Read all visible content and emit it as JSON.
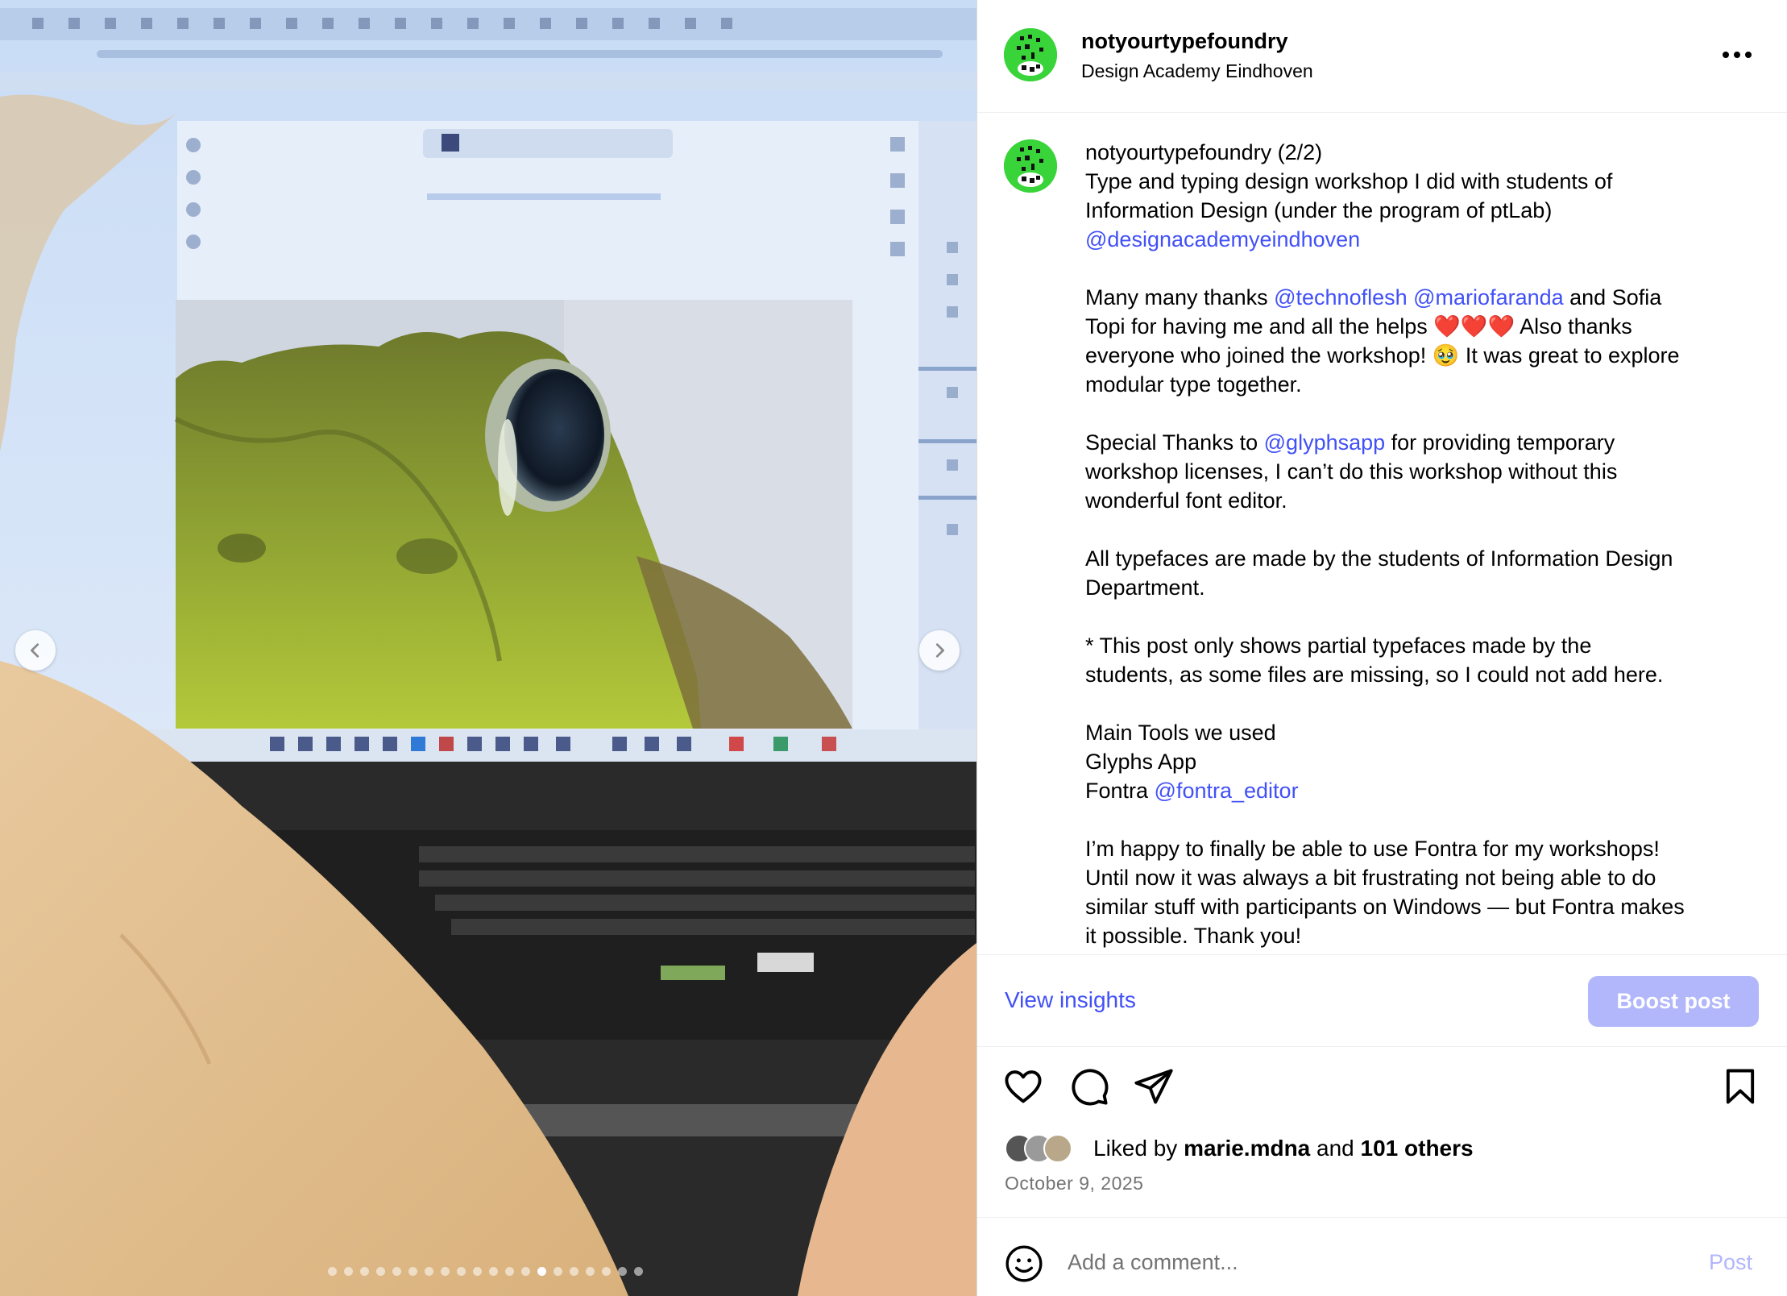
{
  "post": {
    "username": "notyourtypefoundry",
    "location": "Design Academy Eindhoven"
  },
  "caption": {
    "username": "notyourtypefoundry",
    "segments": [
      {
        "t": " (2/2)\nType and typing design workshop I did with students of\nInformation Design (under the program of ptLab)\n",
        "m": false
      },
      {
        "t": "@designacademyeindhoven",
        "m": true
      },
      {
        "t": "\n\nMany many thanks ",
        "m": false
      },
      {
        "t": "@technoflesh",
        "m": true
      },
      {
        "t": " ",
        "m": false
      },
      {
        "t": "@mariofaranda",
        "m": true
      },
      {
        "t": " and Sofia\nTopi for having me and all the helps ❤️❤️❤️ Also thanks\neveryone who joined the workshop! 🥹 It was great to explore\nmodular type together.\n\nSpecial Thanks to ",
        "m": false
      },
      {
        "t": "@glyphsapp",
        "m": true
      },
      {
        "t": " for providing temporary\nworkshop licenses, I can’t do this workshop without this\nwonderful font editor.\n\nAll typefaces are made by the students of Information Design\nDepartment.\n\n* This post only shows partial typefaces made by the\nstudents, as some files are missing, so I could not add here.\n\nMain Tools we used\nGlyphs App\nFontra ",
        "m": false
      },
      {
        "t": "@fontra_editor",
        "m": true
      },
      {
        "t": "\n\nI’m happy to finally be able to use Fontra for my workshops!\nUntil now it was always a bit frustrating not being able to do\nsimilar stuff with participants on Windows — but Fontra makes\nit possible. Thank you!",
        "m": false
      }
    ]
  },
  "insights": {
    "view_label": "View insights",
    "boost_label": "Boost post"
  },
  "likes": {
    "prefix": "Liked by ",
    "user": "marie.mdna",
    "middle": " and ",
    "others": "101 others"
  },
  "date": "October 9, 2025",
  "comment": {
    "placeholder": "Add a comment...",
    "post_label": "Post"
  },
  "carousel": {
    "total": 20,
    "active_index": 13
  },
  "icons": {
    "like": "heart-icon",
    "comment": "comment-bubble-icon",
    "share": "paper-plane-icon",
    "save": "bookmark-icon",
    "more": "ellipsis-icon",
    "emoji": "smiley-icon",
    "prev": "chevron-left-icon",
    "next": "chevron-right-icon"
  },
  "colors": {
    "mention": "#4150f7",
    "boost_bg": "#b2b6fb",
    "post_disabled": "#b2b6fb",
    "muted": "#737373",
    "avatar_green": "#39d33a"
  }
}
